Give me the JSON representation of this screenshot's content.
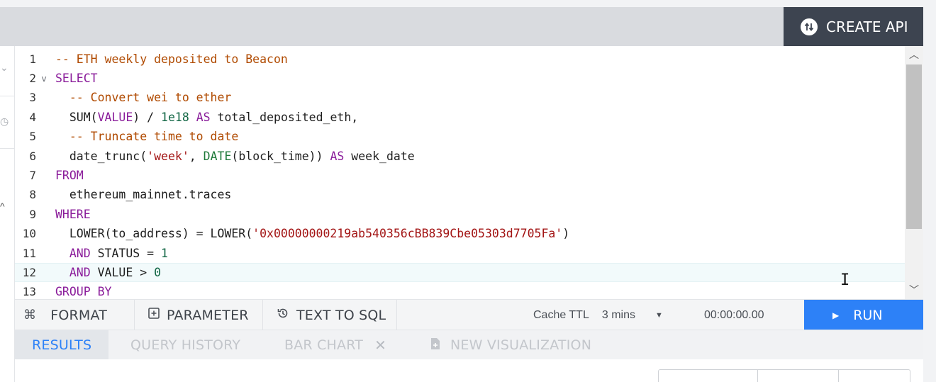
{
  "header": {
    "create_api_label": "CREATE API",
    "create_api_icon": "swap-arrows-icon"
  },
  "editor": {
    "lines": [
      {
        "n": "1",
        "fold": ""
      },
      {
        "n": "2",
        "fold": "v"
      },
      {
        "n": "3",
        "fold": ""
      },
      {
        "n": "4",
        "fold": ""
      },
      {
        "n": "5",
        "fold": ""
      },
      {
        "n": "6",
        "fold": ""
      },
      {
        "n": "7",
        "fold": ""
      },
      {
        "n": "8",
        "fold": ""
      },
      {
        "n": "9",
        "fold": ""
      },
      {
        "n": "10",
        "fold": ""
      },
      {
        "n": "11",
        "fold": ""
      },
      {
        "n": "12",
        "fold": ""
      },
      {
        "n": "13",
        "fold": ""
      }
    ],
    "active_line": 12,
    "code": {
      "l1": "-- ETH weekly deposited to Beacon",
      "l2": "SELECT",
      "l3_indent": "  ",
      "l3": "-- Convert wei to ether",
      "l4_indent": "  ",
      "l4_a": "SUM(",
      "l4_b": "VALUE",
      "l4_c": ") / ",
      "l4_d": "1e18",
      "l4_e": " AS ",
      "l4_f": "total_deposited_eth,",
      "l5_indent": "  ",
      "l5": "-- Truncate time to date",
      "l6_indent": "  ",
      "l6_a": "date_trunc(",
      "l6_b": "'week'",
      "l6_c": ", ",
      "l6_d": "DATE",
      "l6_e": "(block_time)) ",
      "l6_f": "AS",
      "l6_g": " week_date",
      "l7": "FROM",
      "l8_indent": "  ",
      "l8": "ethereum_mainnet.traces",
      "l9": "WHERE",
      "l10_indent": "  ",
      "l10_a": "LOWER(to_address) = LOWER(",
      "l10_b": "'0x00000000219ab540356cBB839Cbe05303d7705Fa'",
      "l10_c": ")",
      "l11_indent": "  ",
      "l11_a": "AND",
      "l11_b": " STATUS = ",
      "l11_c": "1",
      "l12_indent": "  ",
      "l12_a": "AND",
      "l12_b": " VALUE > ",
      "l12_c": "0",
      "l13": "GROUP BY"
    }
  },
  "toolbar": {
    "format_label": "FORMAT",
    "parameter_label": "PARAMETER",
    "text_to_sql_label": "TEXT TO SQL",
    "cache_ttl_label": "Cache TTL",
    "cache_ttl_value": "3 mins",
    "timer": "00:00:00.00",
    "run_label": "RUN"
  },
  "tabs": {
    "results": "RESULTS",
    "query_history": "QUERY HISTORY",
    "bar_chart": "BAR CHART",
    "new_visualization": "NEW VISUALIZATION"
  },
  "colors": {
    "accent": "#2d81f7",
    "dark_button": "#3d4450"
  }
}
